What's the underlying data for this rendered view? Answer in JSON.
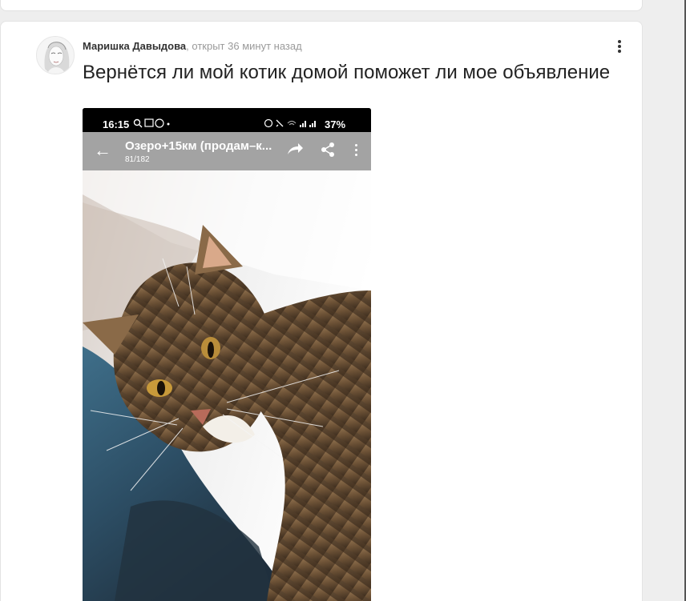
{
  "post": {
    "author": "Маришка Давыдова",
    "opened": ", открыт 36 минут назад",
    "title": "Вернётся ли мой котик домой поможет ли мое объявление"
  },
  "screenshot": {
    "status_time": "16:15",
    "battery": "37%",
    "app_title": "Озеро+15км (продам–к...",
    "app_counter": "81/182"
  },
  "icons": {
    "more": "more-vertical-icon",
    "back": "arrow-back-icon",
    "forward": "forward-icon",
    "share": "share-icon"
  }
}
